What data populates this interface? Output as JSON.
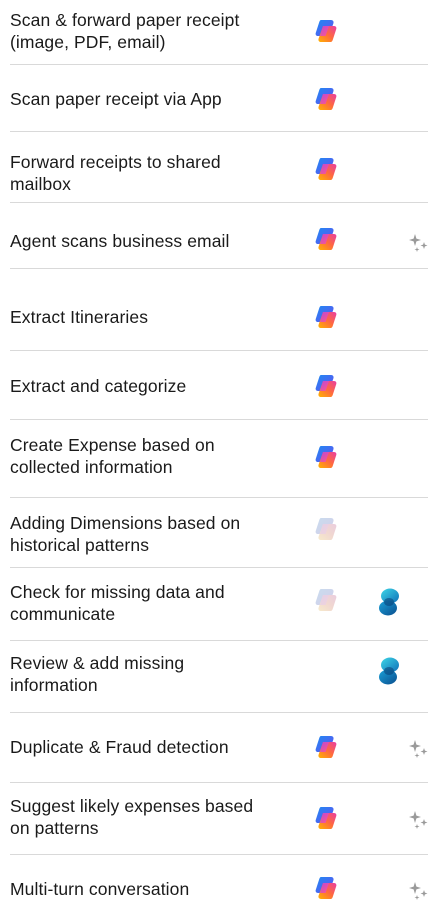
{
  "rows": [
    {
      "label": "Scan & forward paper receipt\n(image, PDF, email)",
      "copilot": "copilot-icon",
      "copilot_faded": false,
      "dataverse": null,
      "sparkle": null
    },
    {
      "label": "Scan paper receipt via App",
      "copilot": "copilot-icon",
      "copilot_faded": false,
      "dataverse": null,
      "sparkle": null
    },
    {
      "label": "Forward receipts to shared\nmailbox",
      "copilot": "copilot-icon",
      "copilot_faded": false,
      "dataverse": null,
      "sparkle": null
    },
    {
      "label": "Agent scans business email",
      "copilot": "copilot-icon",
      "copilot_faded": false,
      "dataverse": null,
      "sparkle": "sparkle-icon"
    },
    {
      "label": "Extract Itineraries",
      "copilot": "copilot-icon",
      "copilot_faded": false,
      "dataverse": null,
      "sparkle": null
    },
    {
      "label": "Extract and categorize",
      "copilot": "copilot-icon",
      "copilot_faded": false,
      "dataverse": null,
      "sparkle": null
    },
    {
      "label": "Create Expense based on\ncollected information",
      "copilot": "copilot-icon",
      "copilot_faded": false,
      "dataverse": null,
      "sparkle": null
    },
    {
      "label": "Adding Dimensions based on\nhistorical patterns",
      "copilot": "copilot-icon",
      "copilot_faded": true,
      "dataverse": null,
      "sparkle": null
    },
    {
      "label": "Check for missing data and\ncommunicate",
      "copilot": "copilot-icon",
      "copilot_faded": true,
      "dataverse": "dataverse-icon",
      "sparkle": null
    },
    {
      "label": "Review & add missing\ninformation",
      "copilot": null,
      "copilot_faded": false,
      "dataverse": "dataverse-icon",
      "sparkle": null
    },
    {
      "label": "Duplicate & Fraud detection",
      "copilot": "copilot-icon",
      "copilot_faded": false,
      "dataverse": null,
      "sparkle": "sparkle-icon"
    },
    {
      "label": "Suggest likely expenses based\non patterns",
      "copilot": "copilot-icon",
      "copilot_faded": false,
      "dataverse": null,
      "sparkle": "sparkle-icon"
    },
    {
      "label": "Multi-turn conversation",
      "copilot": "copilot-icon",
      "copilot_faded": false,
      "dataverse": null,
      "sparkle": "sparkle-icon"
    }
  ]
}
